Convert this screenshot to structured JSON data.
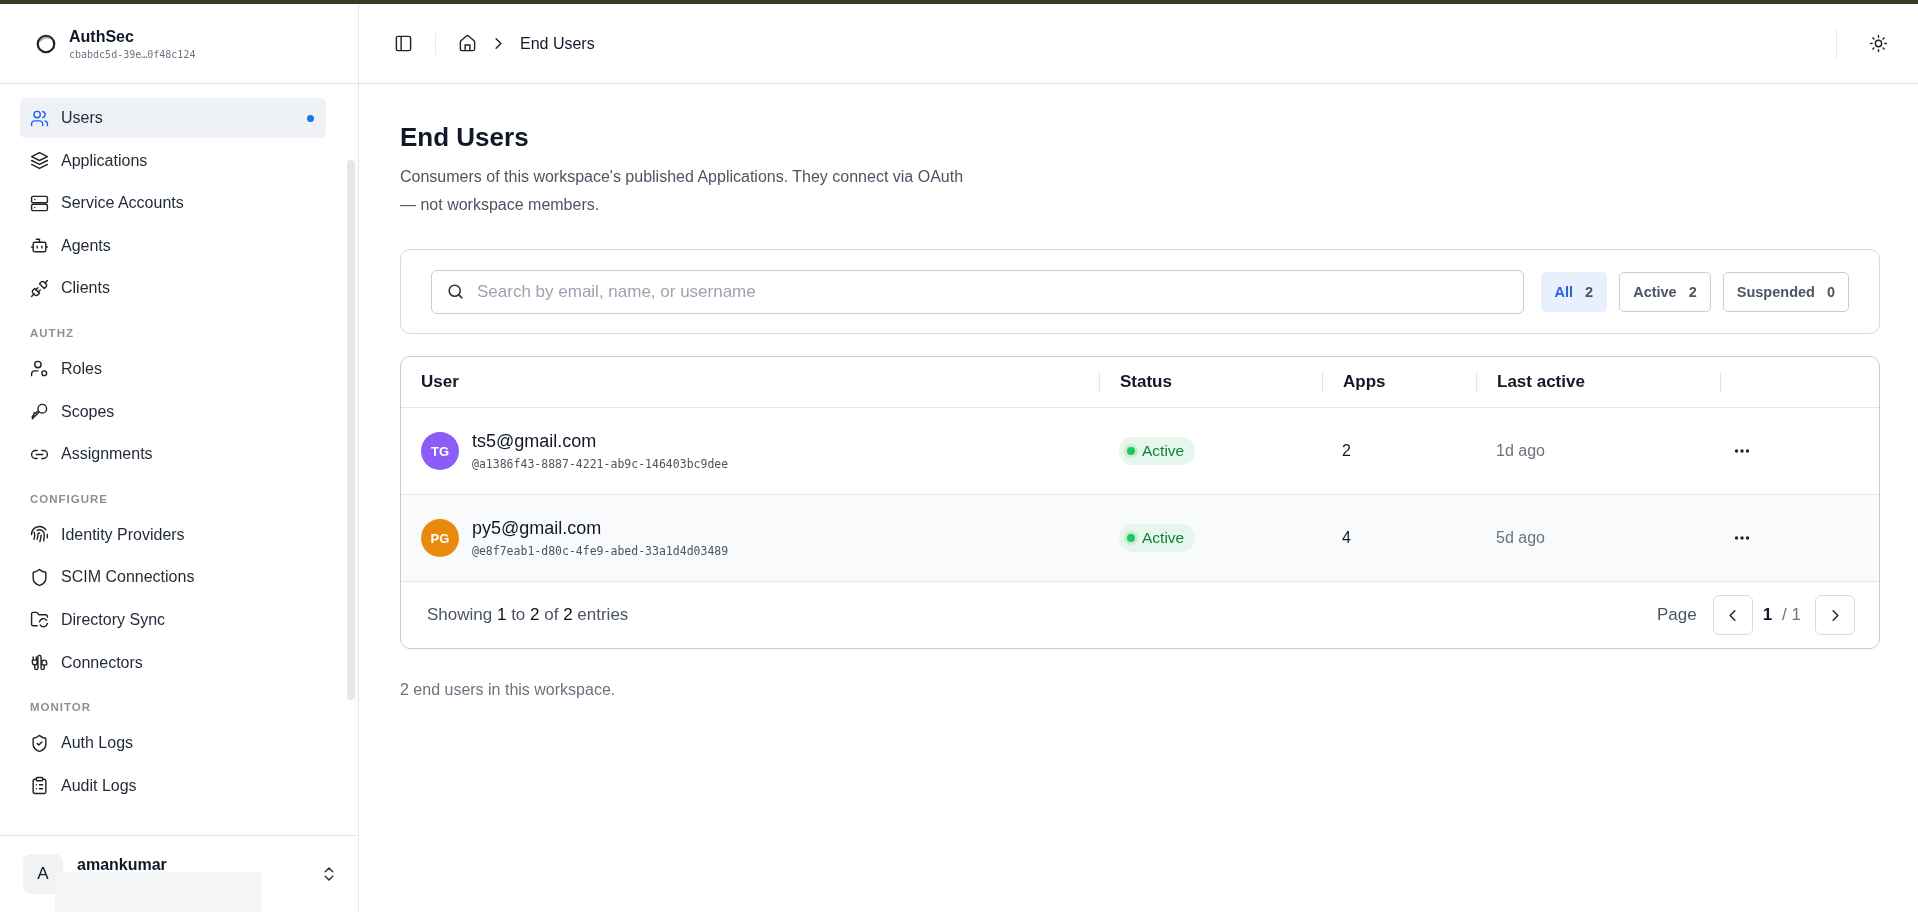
{
  "workspace": {
    "name": "AuthSec",
    "id": "cbabdc5d-39e…0f48c124"
  },
  "sidebar": {
    "sections": [
      {
        "items": [
          {
            "label": "Users",
            "selected": true
          },
          {
            "label": "Applications",
            "selected": false
          },
          {
            "label": "Service Accounts",
            "selected": false
          },
          {
            "label": "Agents",
            "selected": false
          },
          {
            "label": "Clients",
            "selected": false
          }
        ]
      },
      {
        "title": "AUTHZ",
        "items": [
          {
            "label": "Roles",
            "selected": false
          },
          {
            "label": "Scopes",
            "selected": false
          },
          {
            "label": "Assignments",
            "selected": false
          }
        ]
      },
      {
        "title": "CONFIGURE",
        "items": [
          {
            "label": "Identity Providers",
            "selected": false
          },
          {
            "label": "SCIM Connections",
            "selected": false
          },
          {
            "label": "Directory Sync",
            "selected": false
          },
          {
            "label": "Connectors",
            "selected": false
          }
        ]
      },
      {
        "title": "MONITOR",
        "items": [
          {
            "label": "Auth Logs",
            "selected": false
          },
          {
            "label": "Audit Logs",
            "selected": false
          }
        ]
      }
    ]
  },
  "account": {
    "initial": "A",
    "name": "amankumar"
  },
  "breadcrumb": {
    "current": "End Users"
  },
  "page": {
    "title": "End Users",
    "description": "Consumers of this workspace's published Applications. They connect via OAuth — not workspace members."
  },
  "search": {
    "placeholder": "Search by email, name, or username"
  },
  "filters": [
    {
      "label": "All",
      "count": "2",
      "selected": true
    },
    {
      "label": "Active",
      "count": "2",
      "selected": false
    },
    {
      "label": "Suspended",
      "count": "0",
      "selected": false
    }
  ],
  "table": {
    "columns": [
      "User",
      "Status",
      "Apps",
      "Last active"
    ],
    "rows": [
      {
        "initials": "TG",
        "color": "#8b5cf6",
        "email": "ts5@gmail.com",
        "username": "@a1386f43-8887-4221-ab9c-146403bc9dee",
        "status": "Active",
        "apps": "2",
        "last_active": "1d ago"
      },
      {
        "initials": "PG",
        "color": "#ea8a0c",
        "email": "py5@gmail.com",
        "username": "@e8f7eab1-d80c-4fe9-abed-33a1d4d03489",
        "status": "Active",
        "apps": "4",
        "last_active": "5d ago"
      }
    ],
    "footer": "Showing **1** to **2** of **2** entries",
    "pagination": {
      "label": "Page",
      "current": "1",
      "total": "/ 1"
    }
  },
  "summary": "2 end users in this workspace."
}
